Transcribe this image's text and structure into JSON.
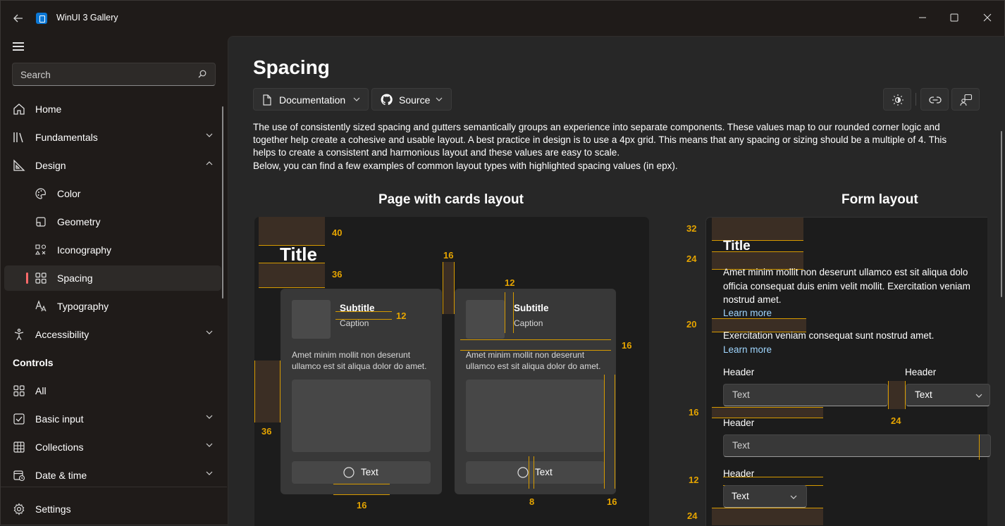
{
  "window": {
    "title": "WinUI 3 Gallery",
    "controls": {
      "minimize": "—",
      "maximize": "☐",
      "close": "✕"
    }
  },
  "search": {
    "placeholder": "Search"
  },
  "nav": {
    "home": "Home",
    "fundamentals": "Fundamentals",
    "design": "Design",
    "color": "Color",
    "geometry": "Geometry",
    "iconography": "Iconography",
    "spacing": "Spacing",
    "typography": "Typography",
    "accessibility": "Accessibility",
    "controls_header": "Controls",
    "all": "All",
    "basic_input": "Basic input",
    "collections": "Collections",
    "date_time": "Date & time",
    "settings": "Settings",
    "selected": "Spacing",
    "accent": "#ff6a6a"
  },
  "page": {
    "title": "Spacing",
    "documentation": "Documentation",
    "source": "Source",
    "description": [
      "The use of consistently sized spacing and gutters semantically groups an experience into separate components. These values map to our rounded corner logic and",
      "together help create a cohesive and usable layout. A best practice in design is to use a 4px grid. This means that any spacing or sizing should be a multiple of 4. This",
      "helps to create a consistent and harmonious layout and these values are easy to scale.",
      "Below, you can find a few examples of common layout types with highlighted spacing values (in epx)."
    ]
  },
  "cards_layout": {
    "heading": "Page with cards layout",
    "title": "Title",
    "card1": {
      "subtitle": "Subtitle",
      "caption": "Caption",
      "body": [
        "Amet minim mollit non deserunt",
        "ullamco est sit aliqua dolor do amet."
      ],
      "button": "Text"
    },
    "card2": {
      "subtitle": "Subtitle",
      "caption": "Caption",
      "body": [
        "Amet minim mollit non deserunt",
        "ullamco est sit aliqua dolor do amet."
      ],
      "button": "Text"
    },
    "spacings": {
      "top": "40",
      "below_title": "36",
      "left": "36",
      "gutter": "16",
      "card_inner": "12",
      "card2_inner": "12",
      "right_bottom": "16",
      "card_right": "16",
      "bottom": "16",
      "icon_gap": "8"
    }
  },
  "form_layout": {
    "heading": "Form layout",
    "title": "Title",
    "paragraph": [
      "Amet minim mollit non deserunt ullamco est sit aliqua dolo",
      "officia consequat duis enim velit mollit. Exercitation veniam",
      "nostrud amet."
    ],
    "learn_more": "Learn more",
    "paragraph2": "Exercitation veniam consequat sunt nostrud amet.",
    "learn_more2": "Learn more",
    "header1": "Header",
    "header2": "Header",
    "header3": "Header",
    "header4": "Header",
    "field1": "Text",
    "combo1": "Text",
    "field2": "Text",
    "combo2": "Text",
    "spacings": {
      "s32": "32",
      "s24a": "24",
      "s20": "20",
      "s16": "16",
      "s24b": "24",
      "s12": "12",
      "s24c": "24"
    }
  },
  "colors": {
    "accent_orange": "#e5a400",
    "highlight": "#3b2e24",
    "link": "#9fd6ff"
  }
}
